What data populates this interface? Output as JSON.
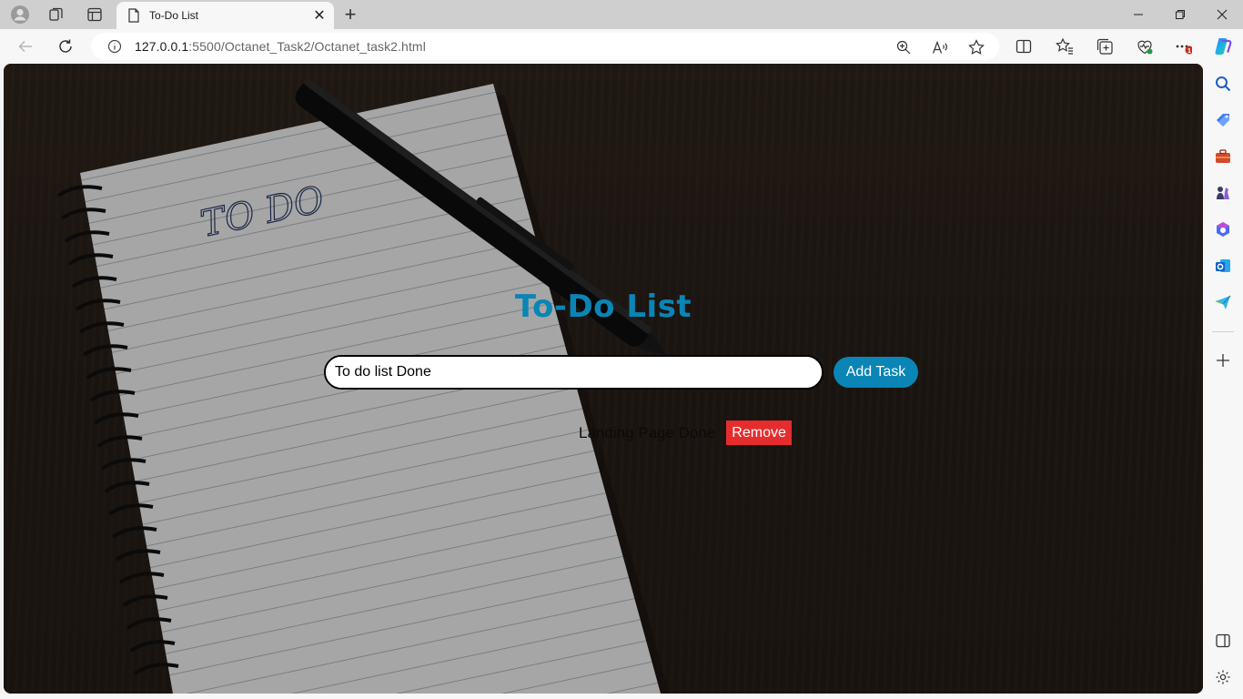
{
  "browser": {
    "tab_title": "To-Do List",
    "tab_close": "✕",
    "new_tab": "+",
    "url_host": "127.0.0.1",
    "url_rest": ":5500/Octanet_Task2/Octanet_task2.html",
    "notification_badge": "1"
  },
  "page": {
    "title": "To-Do List",
    "input_value": "To do list Done",
    "add_button_label": "Add Task",
    "tasks": [
      {
        "text": "Landing Page Done",
        "remove_label": "Remove"
      }
    ],
    "notebook_text": "TO DO"
  },
  "colors": {
    "accent": "#0a85b5",
    "remove": "#e52d2d"
  }
}
